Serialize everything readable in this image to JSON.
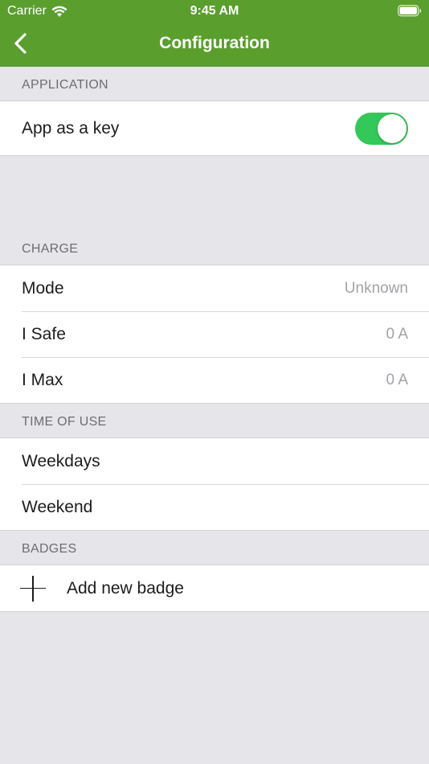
{
  "status_bar": {
    "carrier": "Carrier",
    "time": "9:45 AM",
    "wifi_icon": "wifi-icon",
    "battery_icon": "battery-icon"
  },
  "nav": {
    "title": "Configuration",
    "back_icon": "chevron-left-icon",
    "bar_color": "#5a9e2e"
  },
  "sections": {
    "application": {
      "header": "APPLICATION",
      "app_as_key": {
        "label": "App as a key",
        "toggle_on": true,
        "toggle_color": "#34c759"
      }
    },
    "charge": {
      "header": "CHARGE",
      "rows": [
        {
          "label": "Mode",
          "value": "Unknown"
        },
        {
          "label": "I Safe",
          "value": "0 A"
        },
        {
          "label": "I Max",
          "value": "0 A"
        }
      ]
    },
    "time_of_use": {
      "header": "TIME OF USE",
      "rows": [
        {
          "label": "Weekdays"
        },
        {
          "label": "Weekend"
        }
      ]
    },
    "badges": {
      "header": "BADGES",
      "add_label": "Add new badge",
      "add_icon": "plus-icon"
    }
  }
}
